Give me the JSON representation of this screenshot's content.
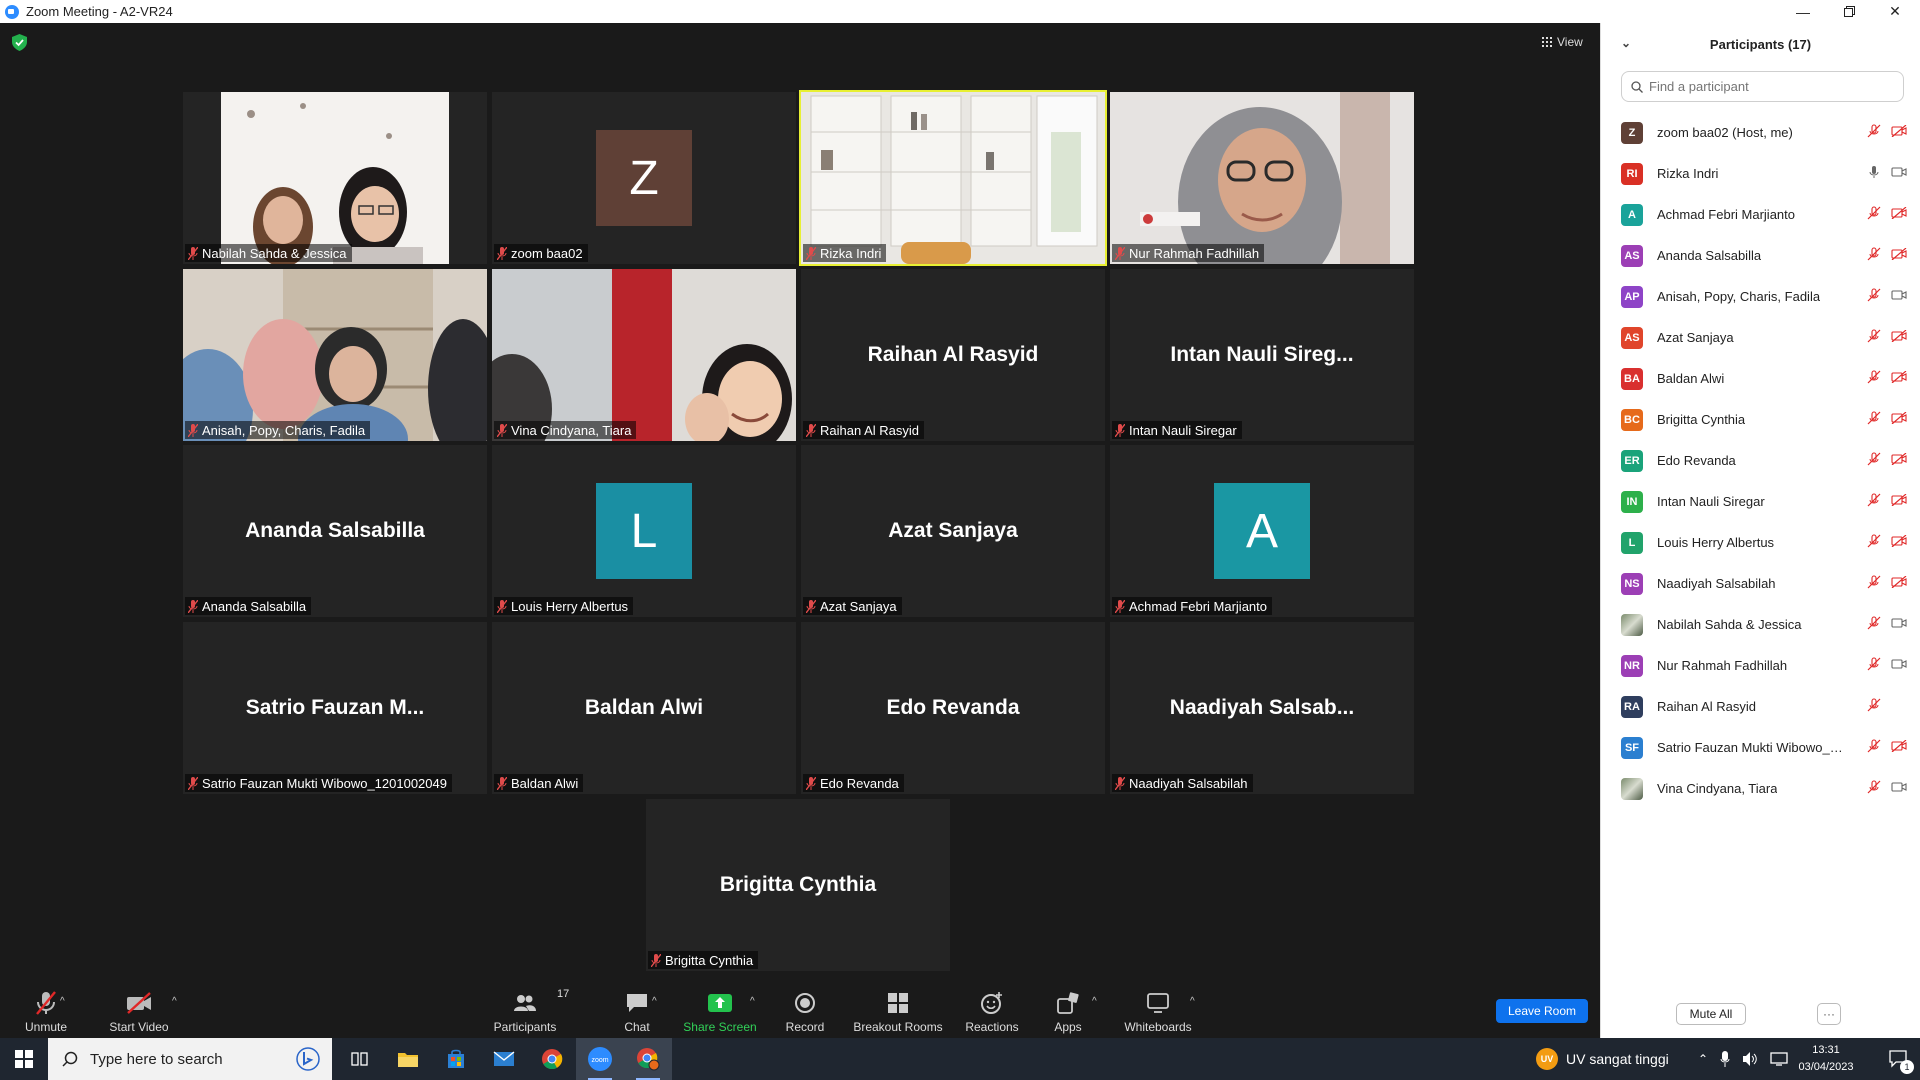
{
  "window": {
    "title": "Zoom Meeting - A2-VR24"
  },
  "meeting": {
    "view_label": "View",
    "tiles": [
      {
        "name": "Nabilah Sahda & Jessica",
        "kind": "video",
        "scene": "two"
      },
      {
        "name": "zoom baa02",
        "kind": "avatar",
        "letter": "Z",
        "color": "#5f4036"
      },
      {
        "name": "Rizka Indri",
        "kind": "video",
        "scene": "shelf",
        "active": true
      },
      {
        "name": "Nur Rahmah Fadhillah",
        "kind": "video",
        "scene": "hijab"
      },
      {
        "name": "Anisah, Popy, Charis, Fadila",
        "kind": "video",
        "scene": "group"
      },
      {
        "name": "Vina Cindyana, Tiara",
        "kind": "video",
        "scene": "red"
      },
      {
        "name": "Raihan Al Rasyid",
        "kind": "name",
        "display": "Raihan Al Rasyid"
      },
      {
        "name": "Intan Nauli Siregar",
        "kind": "name",
        "display": "Intan Nauli Sireg..."
      },
      {
        "name": "Ananda Salsabilla",
        "kind": "name",
        "display": "Ananda Salsabilla"
      },
      {
        "name": "Louis Herry Albertus",
        "kind": "avatar",
        "letter": "L",
        "color": "#1a8fa3"
      },
      {
        "name": "Azat Sanjaya",
        "kind": "name",
        "display": "Azat Sanjaya"
      },
      {
        "name": "Achmad Febri Marjianto",
        "kind": "avatar",
        "letter": "A",
        "color": "#1a97a3"
      },
      {
        "name": "Satrio Fauzan Mukti Wibowo_1201002049",
        "kind": "name",
        "display": "Satrio Fauzan M..."
      },
      {
        "name": "Baldan Alwi",
        "kind": "name",
        "display": "Baldan Alwi"
      },
      {
        "name": "Edo Revanda",
        "kind": "name",
        "display": "Edo Revanda"
      },
      {
        "name": "Naadiyah Salsabilah",
        "kind": "name",
        "display": "Naadiyah Salsab..."
      },
      {
        "name": "Brigitta Cynthia",
        "kind": "name",
        "display": "Brigitta Cynthia"
      }
    ]
  },
  "toolbar": {
    "unmute": "Unmute",
    "start_video": "Start Video",
    "participants": "Participants",
    "participants_count": "17",
    "chat": "Chat",
    "share_screen": "Share Screen",
    "record": "Record",
    "breakout_rooms": "Breakout Rooms",
    "reactions": "Reactions",
    "apps": "Apps",
    "whiteboards": "Whiteboards",
    "leave": "Leave Room"
  },
  "panel": {
    "title": "Participants (17)",
    "search_placeholder": "Find a participant",
    "mute_all": "Mute All",
    "more": "···",
    "participants": [
      {
        "name": "zoom baa02 (Host, me)",
        "initials": "Z",
        "color": "#5f4036",
        "mic": "off",
        "video": "off"
      },
      {
        "name": "Rizka Indri",
        "initials": "RI",
        "color": "#d93025",
        "mic": "on",
        "video": "on"
      },
      {
        "name": "Achmad Febri Marjianto",
        "initials": "A",
        "color": "#1aa39a",
        "mic": "off",
        "video": "off"
      },
      {
        "name": "Ananda Salsabilla",
        "initials": "AS",
        "color": "#9c3fb5",
        "mic": "off",
        "video": "off"
      },
      {
        "name": "Anisah, Popy, Charis, Fadila",
        "initials": "AP",
        "color": "#8e44c7",
        "mic": "off",
        "video": "on"
      },
      {
        "name": "Azat Sanjaya",
        "initials": "AS",
        "color": "#e0452b",
        "mic": "off",
        "video": "off"
      },
      {
        "name": "Baldan Alwi",
        "initials": "BA",
        "color": "#d9302f",
        "mic": "off",
        "video": "off"
      },
      {
        "name": "Brigitta Cynthia",
        "initials": "BC",
        "color": "#e66a1b",
        "mic": "off",
        "video": "off"
      },
      {
        "name": "Edo Revanda",
        "initials": "ER",
        "color": "#1aa37a",
        "mic": "off",
        "video": "off"
      },
      {
        "name": "Intan Nauli Siregar",
        "initials": "IN",
        "color": "#2db04b",
        "mic": "off",
        "video": "off"
      },
      {
        "name": "Louis Herry Albertus",
        "initials": "L",
        "color": "#21a36b",
        "mic": "off",
        "video": "off"
      },
      {
        "name": "Naadiyah Salsabilah",
        "initials": "NS",
        "color": "#9c3fb5",
        "mic": "off",
        "video": "off"
      },
      {
        "name": "Nabilah Sahda & Jessica",
        "initials": "",
        "color": "#777777",
        "photo": true,
        "mic": "off",
        "video": "on"
      },
      {
        "name": "Nur Rahmah Fadhillah",
        "initials": "NR",
        "color": "#9c3fb5",
        "mic": "off",
        "video": "on"
      },
      {
        "name": "Raihan Al Rasyid",
        "initials": "RA",
        "color": "#2f3e5e",
        "mic": "off",
        "video": "none"
      },
      {
        "name": "Satrio Fauzan Mukti Wibowo_12...",
        "initials": "SF",
        "color": "#2b7fd0",
        "mic": "off",
        "video": "off"
      },
      {
        "name": "Vina Cindyana, Tiara",
        "initials": "",
        "color": "#777777",
        "photo": true,
        "mic": "off",
        "video": "on"
      }
    ]
  },
  "taskbar": {
    "search_placeholder": "Type here to search",
    "weather": "UV sangat tinggi",
    "weather_badge": "UV",
    "time": "13:31",
    "date": "03/04/2023",
    "notifications": "1"
  }
}
